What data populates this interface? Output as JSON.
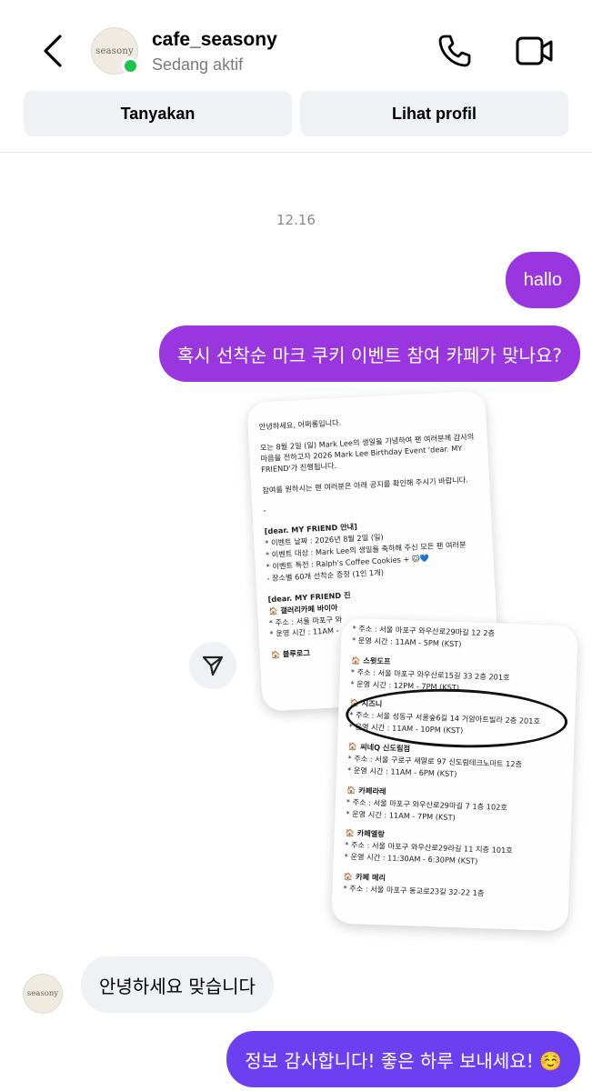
{
  "header": {
    "username": "cafe_seasony",
    "status": "Sedang aktif",
    "avatar_text": "seasony",
    "ask_label": "Tanyakan",
    "profile_label": "Lihat profil"
  },
  "chat": {
    "date": "12.16",
    "messages": [
      {
        "from": "me",
        "text": "hallo"
      },
      {
        "from": "me",
        "text": "혹시 선착순 마크 쿠키 이벤트 참여 카페가 맞나요?"
      },
      {
        "from": "them",
        "text": "안녕하세요 맞습니다"
      },
      {
        "from": "me",
        "text": "정보 감사합니다! 좋은 하루 보내세요! ☺️"
      }
    ]
  },
  "shared_image_1": {
    "lines": [
      "안녕하세요, 어쩌롱입니다.",
      "오는 8월 2일 (일) Mark Lee의 생일을 기념하여 팬 여러분께 감사의 마음을 전하고자 2026 Mark Lee Birthday Event 'dear. MY FRIEND'가 진행됩니다.",
      "참여를 원하시는 팬 여러분은 아래 공지를 확인해 주시기 바랍니다.",
      "-",
      "[dear. MY FRIEND 안내]",
      "* 이벤트 날짜 : 2026년 8월 2일 (일)",
      "* 이벤트 대상 : Mark Lee의 생일을 축하해 주신 모든 팬 여러분",
      "* 이벤트 특전 : Ralph's Coffee Cookies + 🐱💙",
      "- 장소별 60개 선착순 증정 (1인 1개)",
      "[dear. MY FRIEND 진",
      "🏠 갤러리카페 바이아",
      "* 주소 : 서울 마포구 와",
      "* 운영 시간 : 11AM -",
      "🏠 블루로그"
    ]
  },
  "shared_image_2": {
    "lines": [
      "* 주소 : 서울 마포구 와우산로29마길 12 2층",
      "* 운영 시간 : 11AM - 5PM (KST)",
      "🏠 스윗도프",
      "* 주소 : 서울 마포구 와우산로15길 33 2층 201호",
      "* 운영 시간 : 12PM - 7PM (KST)",
      "🏠 시즈니",
      "* 주소 : 서울 성동구 서울숲6길 14 거암아트빌라 2층 201호",
      "* 운영 시간 : 11AM - 10PM (KST)",
      "🏠 씨네Q 신도림점",
      "* 주소 : 서울 구로구 새말로 97 신도림테크노마트 12층",
      "* 운영 시간 : 11AM - 6PM (KST)",
      "🏠 카페라레",
      "* 주소 : 서울 마포구 와우산로29마길 7 1층 102호",
      "* 운영 시간 : 11AM - 7PM (KST)",
      "🏠 카페엘랑",
      "* 주소 : 서울 마포구 와우산로29라길 11 지층 101호",
      "* 운영 시간 : 11:30AM - 6:30PM (KST)",
      "🏠 카페 메리",
      "* 주소 : 서울 마포구 동교로23길 32-22 1층"
    ]
  },
  "icons": {
    "back": "chevron-left-icon",
    "call": "phone-icon",
    "video": "video-camera-icon",
    "share": "send-icon"
  },
  "colors": {
    "bubble_purple": "#9a36e0",
    "bubble_blue_violet": "#6c40f0",
    "bubble_incoming": "#eff1f4",
    "online": "#1fc24a"
  }
}
